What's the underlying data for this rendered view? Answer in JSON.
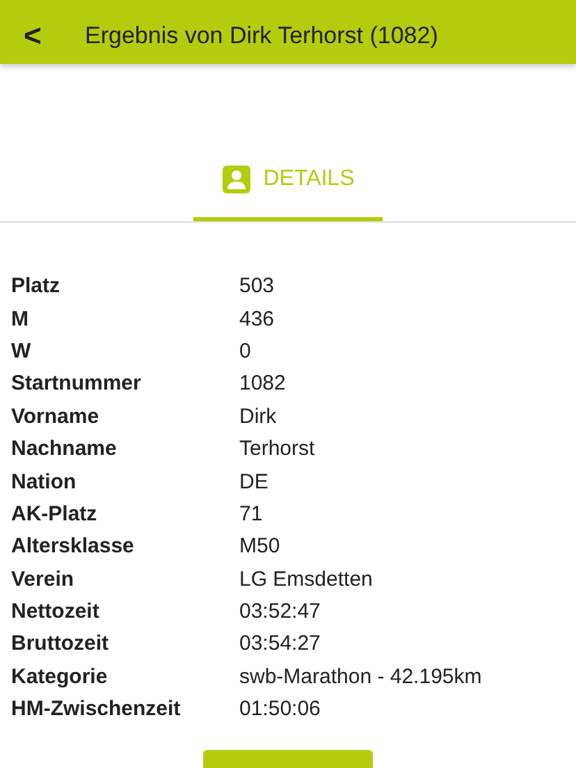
{
  "header": {
    "back": "<",
    "title": "Ergebnis von Dirk Terhorst (1082)"
  },
  "tabs": [
    {
      "label": "DETAILS",
      "selected": true
    }
  ],
  "details": [
    {
      "label": "Platz",
      "value": "503"
    },
    {
      "label": "M",
      "value": "436"
    },
    {
      "label": "W",
      "value": "0"
    },
    {
      "label": "Startnummer",
      "value": "1082"
    },
    {
      "label": "Vorname",
      "value": "Dirk"
    },
    {
      "label": "Nachname",
      "value": "Terhorst"
    },
    {
      "label": "Nation",
      "value": "DE"
    },
    {
      "label": "AK-Platz",
      "value": "71"
    },
    {
      "label": "Altersklasse",
      "value": "M50"
    },
    {
      "label": "Verein",
      "value": "LG Emsdetten"
    },
    {
      "label": "Nettozeit",
      "value": "03:52:47"
    },
    {
      "label": "Bruttozeit",
      "value": "03:54:27"
    },
    {
      "label": "Kategorie",
      "value": "swb-Marathon - 42.195km"
    },
    {
      "label": "HM-Zwischenzeit",
      "value": "01:50:06"
    }
  ]
}
